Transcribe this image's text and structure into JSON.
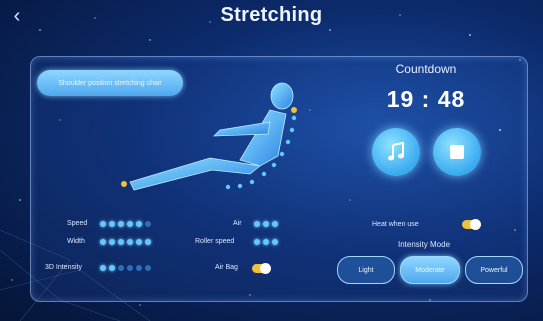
{
  "header": {
    "title": "Stretching",
    "back_icon": "chevron-left-icon"
  },
  "preset_button": {
    "label": "Shoulder position stretching chair"
  },
  "timer": {
    "label": "Countdown",
    "value": "19 : 48"
  },
  "controls": {
    "music_icon": "music-icon",
    "stop_icon": "stop-icon"
  },
  "settings": {
    "speed": {
      "label": "Speed",
      "level": 5,
      "max": 6
    },
    "width": {
      "label": "Width",
      "level": 6,
      "max": 6
    },
    "intensity_3d": {
      "label": "3D Intensity",
      "level": 2,
      "max": 6
    },
    "air": {
      "label": "Air",
      "level": 3,
      "max": 3
    },
    "roller_speed": {
      "label": "Roller speed",
      "level": 3,
      "max": 3
    },
    "air_bag": {
      "label": "Air Bag",
      "on": true
    },
    "heat": {
      "label": "Heat when use",
      "on": true
    }
  },
  "intensity_mode": {
    "label": "Intensity Mode",
    "options": [
      {
        "label": "Light",
        "active": false
      },
      {
        "label": "Moderate",
        "active": true
      },
      {
        "label": "Powerful",
        "active": false
      }
    ]
  },
  "colors": {
    "accent": "#4fa8ee",
    "toggle": "#f0c23a",
    "background": "#0c2a6b"
  }
}
